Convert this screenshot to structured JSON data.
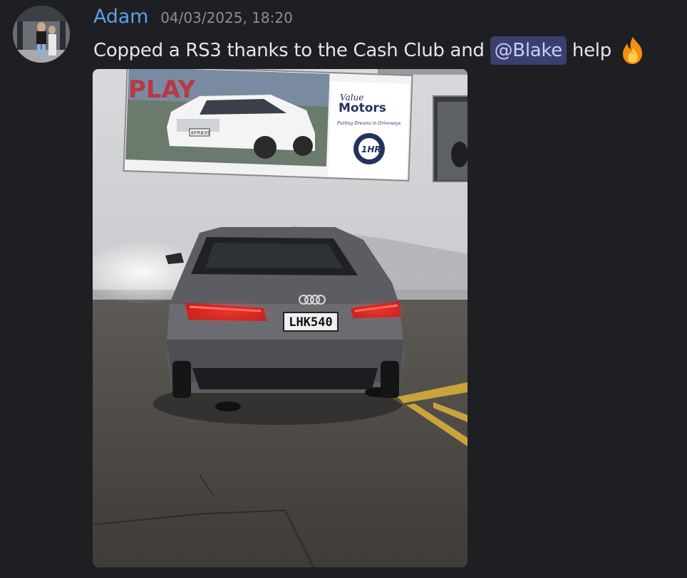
{
  "message": {
    "author": "Adam",
    "timestamp": "04/03/2025, 18:20",
    "text_before": "Copped a RS3 thanks to the Cash Club and",
    "mention": "@Blake",
    "text_after": "help",
    "emoji": "fire-emoji"
  },
  "attachment": {
    "billboard_brand_top": "Value",
    "billboard_brand": "Motors",
    "billboard_slogan": "Putting Dreams in Driveways",
    "billboard_badge": "1HR",
    "billboard_small_plate": "KFR839",
    "billboard_partial_text": "PLAY",
    "car_plate": "LHK540"
  },
  "colors": {
    "background": "#1e1f22",
    "username": "#5aa0e8",
    "mention_bg": "#3b3f6e",
    "mention_text": "#c6cdff"
  }
}
